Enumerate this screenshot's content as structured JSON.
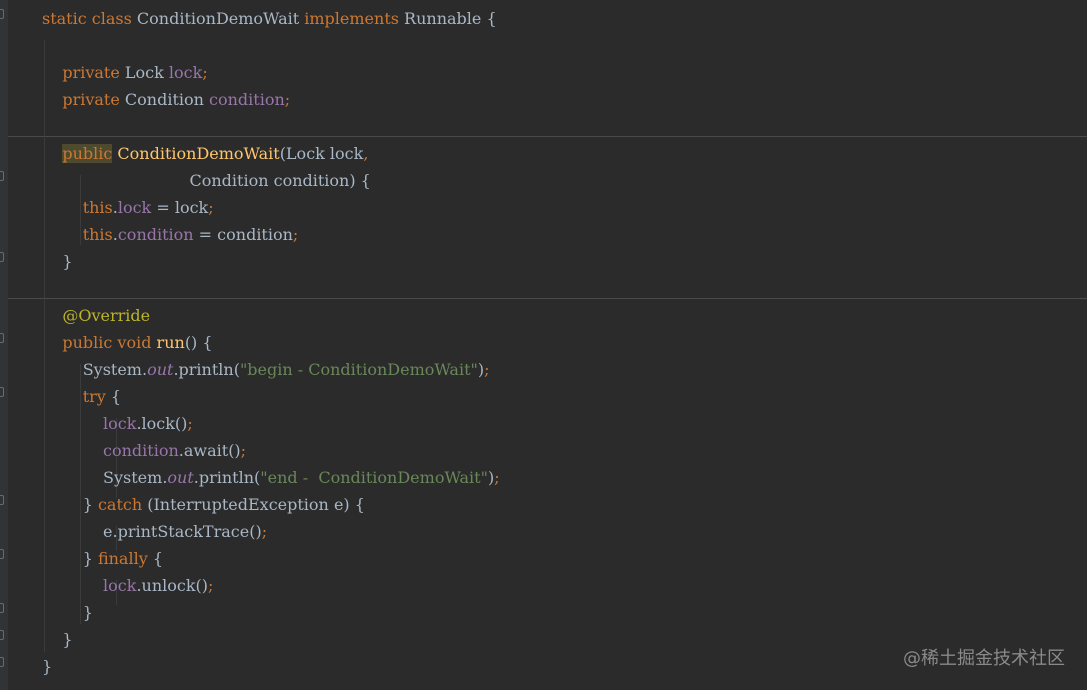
{
  "code": {
    "lines": [
      [
        {
          "t": "static",
          "c": "kw"
        },
        {
          "t": " "
        },
        {
          "t": "class",
          "c": "kw"
        },
        {
          "t": " ConditionDemoWait "
        },
        {
          "t": "implements",
          "c": "kw"
        },
        {
          "t": " Runnable {"
        }
      ],
      [],
      [
        {
          "t": "    "
        },
        {
          "t": "private",
          "c": "kw"
        },
        {
          "t": " Lock "
        },
        {
          "t": "lock",
          "c": "fld"
        },
        {
          "t": ";",
          "c": "semi"
        }
      ],
      [
        {
          "t": "    "
        },
        {
          "t": "private",
          "c": "kw"
        },
        {
          "t": " Condition "
        },
        {
          "t": "condition",
          "c": "fld"
        },
        {
          "t": ";",
          "c": "semi"
        }
      ],
      [],
      [
        {
          "t": "    "
        },
        {
          "t": "public",
          "c": "kw hl"
        },
        {
          "t": " "
        },
        {
          "t": "ConditionDemoWait",
          "c": "fn"
        },
        {
          "t": "(Lock lock"
        },
        {
          "t": ",",
          "c": "semi"
        }
      ],
      [
        {
          "t": "                             Condition condition) {"
        }
      ],
      [
        {
          "t": "        "
        },
        {
          "t": "this",
          "c": "kw"
        },
        {
          "t": "."
        },
        {
          "t": "lock",
          "c": "fld"
        },
        {
          "t": " = lock"
        },
        {
          "t": ";",
          "c": "semi"
        }
      ],
      [
        {
          "t": "        "
        },
        {
          "t": "this",
          "c": "kw"
        },
        {
          "t": "."
        },
        {
          "t": "condition",
          "c": "fld"
        },
        {
          "t": " = condition"
        },
        {
          "t": ";",
          "c": "semi"
        }
      ],
      [
        {
          "t": "    }"
        }
      ],
      [],
      [
        {
          "t": "    "
        },
        {
          "t": "@Override",
          "c": "ann"
        }
      ],
      [
        {
          "t": "    "
        },
        {
          "t": "public",
          "c": "kw"
        },
        {
          "t": " "
        },
        {
          "t": "void",
          "c": "kw"
        },
        {
          "t": " "
        },
        {
          "t": "run",
          "c": "fn"
        },
        {
          "t": "() {"
        }
      ],
      [
        {
          "t": "        System."
        },
        {
          "t": "out",
          "c": "sfld"
        },
        {
          "t": ".println("
        },
        {
          "t": "\"begin - ConditionDemoWait\"",
          "c": "str"
        },
        {
          "t": ")"
        },
        {
          "t": ";",
          "c": "semi"
        }
      ],
      [
        {
          "t": "        "
        },
        {
          "t": "try",
          "c": "kw"
        },
        {
          "t": " {"
        }
      ],
      [
        {
          "t": "            "
        },
        {
          "t": "lock",
          "c": "fld"
        },
        {
          "t": ".lock()"
        },
        {
          "t": ";",
          "c": "semi"
        }
      ],
      [
        {
          "t": "            "
        },
        {
          "t": "condition",
          "c": "fld"
        },
        {
          "t": ".await()"
        },
        {
          "t": ";",
          "c": "semi"
        }
      ],
      [
        {
          "t": "            System."
        },
        {
          "t": "out",
          "c": "sfld"
        },
        {
          "t": ".println("
        },
        {
          "t": "\"end -  ConditionDemoWait\"",
          "c": "str"
        },
        {
          "t": ")"
        },
        {
          "t": ";",
          "c": "semi"
        }
      ],
      [
        {
          "t": "        } "
        },
        {
          "t": "catch",
          "c": "kw"
        },
        {
          "t": " (InterruptedException e) {"
        }
      ],
      [
        {
          "t": "            e.printStackTrace()"
        },
        {
          "t": ";",
          "c": "semi"
        }
      ],
      [
        {
          "t": "        } "
        },
        {
          "t": "finally",
          "c": "kw"
        },
        {
          "t": " {"
        }
      ],
      [
        {
          "t": "            "
        },
        {
          "t": "lock",
          "c": "fld"
        },
        {
          "t": ".unlock()"
        },
        {
          "t": ";",
          "c": "semi"
        }
      ],
      [
        {
          "t": "        }"
        }
      ],
      [
        {
          "t": "    }"
        }
      ],
      [
        {
          "t": "}"
        }
      ]
    ]
  },
  "watermark": "@稀土掘金技术社区",
  "colors": {
    "background": "#2b2b2b",
    "keyword": "#cc7832",
    "field": "#9876aa",
    "method": "#ffc66d",
    "annotation": "#bbb529",
    "string": "#6a8759",
    "plain": "#a9b7c6"
  }
}
